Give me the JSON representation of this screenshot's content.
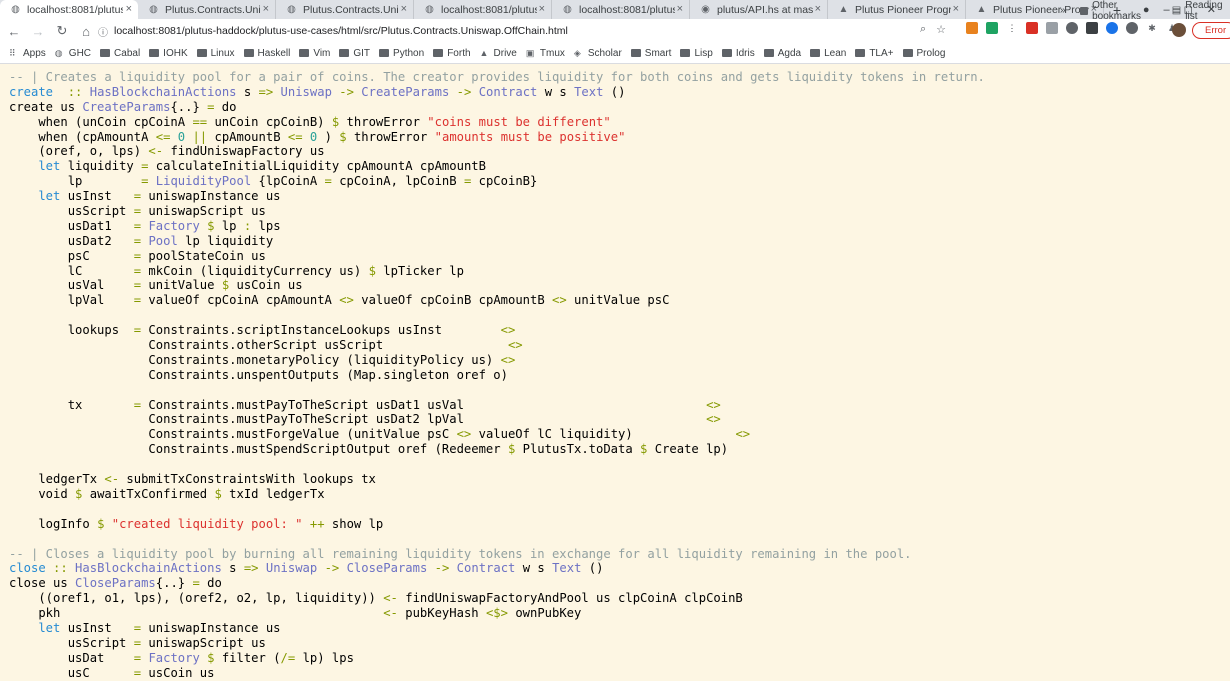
{
  "tabs": [
    {
      "label": "localhost:8081/plutus",
      "icon": "globe-icon",
      "active": true
    },
    {
      "label": "Plutus.Contracts.Unis",
      "icon": "globe-icon"
    },
    {
      "label": "Plutus.Contracts.Unis",
      "icon": "globe-icon"
    },
    {
      "label": "localhost:8081/plutus",
      "icon": "globe-icon"
    },
    {
      "label": "localhost:8081/plutus",
      "icon": "globe-icon"
    },
    {
      "label": "plutus/API.hs at mas",
      "icon": "github-icon"
    },
    {
      "label": "Plutus Pioneer Progr",
      "icon": "drive-icon"
    },
    {
      "label": "Plutus Pioneer Progr",
      "icon": "drive-icon"
    }
  ],
  "new_tab": "+",
  "window_controls": {
    "minimize": "–",
    "maximize": "◻",
    "close": "✕"
  },
  "toolbar": {
    "url": "localhost:8081/plutus-haddock/plutus-use-cases/html/src/Plutus.Contracts.Uniswap.OffChain.html",
    "error_label": "Error"
  },
  "bookmarks": [
    {
      "label": "Apps",
      "icon": "apps-icon"
    },
    {
      "label": "GHC",
      "icon": "globe-icon"
    },
    {
      "label": "Cabal",
      "icon": "folder-icon"
    },
    {
      "label": "IOHK",
      "icon": "folder-icon"
    },
    {
      "label": "Linux",
      "icon": "folder-icon"
    },
    {
      "label": "Haskell",
      "icon": "folder-icon"
    },
    {
      "label": "Vim",
      "icon": "folder-icon"
    },
    {
      "label": "GIT",
      "icon": "folder-icon"
    },
    {
      "label": "Python",
      "icon": "folder-icon"
    },
    {
      "label": "Forth",
      "icon": "folder-icon"
    },
    {
      "label": "Drive",
      "icon": "drive-icon"
    },
    {
      "label": "Tmux",
      "icon": "tmux-icon"
    },
    {
      "label": "Scholar",
      "icon": "scholar-icon"
    },
    {
      "label": "Smart",
      "icon": "folder-icon"
    },
    {
      "label": "Lisp",
      "icon": "folder-icon"
    },
    {
      "label": "Idris",
      "icon": "folder-icon"
    },
    {
      "label": "Agda",
      "icon": "folder-icon"
    },
    {
      "label": "Lean",
      "icon": "folder-icon"
    },
    {
      "label": "TLA+",
      "icon": "folder-icon"
    },
    {
      "label": "Prolog",
      "icon": "folder-icon"
    }
  ],
  "bookmarks_overflow": "»",
  "other_bookmarks": "Other bookmarks",
  "reading_list": "Reading list",
  "code_lines": [
    [
      [
        "c",
        "-- | Creates a liquidity pool for a pair of coins. The creator provides liquidity for both coins and gets liquidity tokens in return."
      ]
    ],
    [
      [
        "k",
        "create"
      ],
      [
        "",
        "  "
      ],
      [
        "op",
        "::"
      ],
      [
        "",
        ""
      ],
      [
        "ty",
        " HasBlockchainActions"
      ],
      [
        "",
        " s "
      ],
      [
        "op",
        "=>"
      ],
      [
        "ty",
        " Uniswap"
      ],
      [
        "",
        " "
      ],
      [
        "op",
        "->"
      ],
      [
        "ty",
        " CreateParams"
      ],
      [
        "",
        " "
      ],
      [
        "op",
        "->"
      ],
      [
        "ty",
        " Contract"
      ],
      [
        "",
        " w s "
      ],
      [
        "ty",
        "Text"
      ],
      [
        "",
        " ()"
      ]
    ],
    [
      [
        "",
        "create us "
      ],
      [
        "ty",
        "CreateParams"
      ],
      [
        "",
        "{..} "
      ],
      [
        "op",
        "="
      ],
      [
        "",
        " do"
      ]
    ],
    [
      [
        "",
        "    when (unCoin cpCoinA "
      ],
      [
        "op",
        "=="
      ],
      [
        "",
        " unCoin cpCoinB) "
      ],
      [
        "op",
        "$"
      ],
      [
        "",
        " throwError "
      ],
      [
        "st",
        "\"coins must be different\""
      ]
    ],
    [
      [
        "",
        "    when (cpAmountA "
      ],
      [
        "op",
        "<="
      ],
      [
        "",
        " "
      ],
      [
        "n",
        "0"
      ],
      [
        "",
        " "
      ],
      [
        "op",
        "||"
      ],
      [
        "",
        " cpAmountB "
      ],
      [
        "op",
        "<="
      ],
      [
        "",
        " "
      ],
      [
        "n",
        "0"
      ],
      [
        "",
        " ) "
      ],
      [
        "op",
        "$"
      ],
      [
        "",
        " throwError "
      ],
      [
        "st",
        "\"amounts must be positive\""
      ]
    ],
    [
      [
        "",
        "    (oref, o, lps) "
      ],
      [
        "op",
        "<-"
      ],
      [
        "",
        " findUniswapFactory us"
      ]
    ],
    [
      [
        "k",
        "    let"
      ],
      [
        "",
        " liquidity "
      ],
      [
        "op",
        "="
      ],
      [
        "",
        " calculateInitialLiquidity cpAmountA cpAmountB"
      ]
    ],
    [
      [
        "",
        "        lp        "
      ],
      [
        "op",
        "="
      ],
      [
        "",
        " "
      ],
      [
        "ty",
        "LiquidityPool"
      ],
      [
        "",
        " {lpCoinA "
      ],
      [
        "op",
        "="
      ],
      [
        "",
        " cpCoinA, lpCoinB "
      ],
      [
        "op",
        "="
      ],
      [
        "",
        " cpCoinB}"
      ]
    ],
    [
      [
        "k",
        "    let"
      ],
      [
        "",
        " usInst   "
      ],
      [
        "op",
        "="
      ],
      [
        "",
        " uniswapInstance us"
      ]
    ],
    [
      [
        "",
        "        usScript "
      ],
      [
        "op",
        "="
      ],
      [
        "",
        " uniswapScript us"
      ]
    ],
    [
      [
        "",
        "        usDat1   "
      ],
      [
        "op",
        "="
      ],
      [
        "",
        " "
      ],
      [
        "ty",
        "Factory"
      ],
      [
        "",
        " "
      ],
      [
        "op",
        "$"
      ],
      [
        "",
        " lp "
      ],
      [
        "op",
        ":"
      ],
      [
        "",
        " lps"
      ]
    ],
    [
      [
        "",
        "        usDat2   "
      ],
      [
        "op",
        "="
      ],
      [
        "",
        " "
      ],
      [
        "ty",
        "Pool"
      ],
      [
        "",
        " lp liquidity"
      ]
    ],
    [
      [
        "",
        "        psC      "
      ],
      [
        "op",
        "="
      ],
      [
        "",
        " poolStateCoin us"
      ]
    ],
    [
      [
        "",
        "        lC       "
      ],
      [
        "op",
        "="
      ],
      [
        "",
        " mkCoin (liquidityCurrency us) "
      ],
      [
        "op",
        "$"
      ],
      [
        "",
        " lpTicker lp"
      ]
    ],
    [
      [
        "",
        "        usVal    "
      ],
      [
        "op",
        "="
      ],
      [
        "",
        " unitValue "
      ],
      [
        "op",
        "$"
      ],
      [
        "",
        " usCoin us"
      ]
    ],
    [
      [
        "",
        "        lpVal    "
      ],
      [
        "op",
        "="
      ],
      [
        "",
        " valueOf cpCoinA cpAmountA "
      ],
      [
        "op",
        "<>"
      ],
      [
        "",
        " valueOf cpCoinB cpAmountB "
      ],
      [
        "op",
        "<>"
      ],
      [
        "",
        " unitValue psC"
      ]
    ],
    [
      [
        "",
        ""
      ]
    ],
    [
      [
        "",
        "        lookups  "
      ],
      [
        "op",
        "="
      ],
      [
        "",
        " Constraints.scriptInstanceLookups usInst        "
      ],
      [
        "op",
        "<>"
      ]
    ],
    [
      [
        "",
        "                   Constraints.otherScript usScript                 "
      ],
      [
        "op",
        "<>"
      ]
    ],
    [
      [
        "",
        "                   Constraints.monetaryPolicy (liquidityPolicy us) "
      ],
      [
        "op",
        "<>"
      ]
    ],
    [
      [
        "",
        "                   Constraints.unspentOutputs (Map.singleton oref o)"
      ]
    ],
    [
      [
        "",
        ""
      ]
    ],
    [
      [
        "",
        "        tx       "
      ],
      [
        "op",
        "="
      ],
      [
        "",
        " Constraints.mustPayToTheScript usDat1 usVal                                 "
      ],
      [
        "op",
        "<>"
      ]
    ],
    [
      [
        "",
        "                   Constraints.mustPayToTheScript usDat2 lpVal                                 "
      ],
      [
        "op",
        "<>"
      ]
    ],
    [
      [
        "",
        "                   Constraints.mustForgeValue (unitValue psC "
      ],
      [
        "op",
        "<>"
      ],
      [
        "",
        " valueOf lC liquidity)              "
      ],
      [
        "op",
        "<>"
      ]
    ],
    [
      [
        "",
        "                   Constraints.mustSpendScriptOutput oref (Redeemer "
      ],
      [
        "op",
        "$"
      ],
      [
        "",
        " PlutusTx.toData "
      ],
      [
        "op",
        "$"
      ],
      [
        "",
        " Create lp)"
      ]
    ],
    [
      [
        "",
        ""
      ]
    ],
    [
      [
        "",
        "    ledgerTx "
      ],
      [
        "op",
        "<-"
      ],
      [
        "",
        " submitTxConstraintsWith lookups tx"
      ]
    ],
    [
      [
        "",
        "    void "
      ],
      [
        "op",
        "$"
      ],
      [
        "",
        " awaitTxConfirmed "
      ],
      [
        "op",
        "$"
      ],
      [
        "",
        " txId ledgerTx"
      ]
    ],
    [
      [
        "",
        ""
      ]
    ],
    [
      [
        "",
        "    logInfo "
      ],
      [
        "op",
        "$"
      ],
      [
        "",
        " "
      ],
      [
        "st",
        "\"created liquidity pool: \""
      ],
      [
        "",
        " "
      ],
      [
        "op",
        "++"
      ],
      [
        "",
        " show lp"
      ]
    ],
    [
      [
        "",
        ""
      ]
    ],
    [
      [
        "c",
        "-- | Closes a liquidity pool by burning all remaining liquidity tokens in exchange for all liquidity remaining in the pool."
      ]
    ],
    [
      [
        "k",
        "close"
      ],
      [
        "",
        " "
      ],
      [
        "op",
        "::"
      ],
      [
        "ty",
        " HasBlockchainActions"
      ],
      [
        "",
        " s "
      ],
      [
        "op",
        "=>"
      ],
      [
        "ty",
        " Uniswap"
      ],
      [
        "",
        " "
      ],
      [
        "op",
        "->"
      ],
      [
        "ty",
        " CloseParams"
      ],
      [
        "",
        " "
      ],
      [
        "op",
        "->"
      ],
      [
        "ty",
        " Contract"
      ],
      [
        "",
        " w s "
      ],
      [
        "ty",
        "Text"
      ],
      [
        "",
        " ()"
      ]
    ],
    [
      [
        "",
        "close us "
      ],
      [
        "ty",
        "CloseParams"
      ],
      [
        "",
        "{..} "
      ],
      [
        "op",
        "="
      ],
      [
        "",
        " do"
      ]
    ],
    [
      [
        "",
        "    ((oref1, o1, lps), (oref2, o2, lp, liquidity)) "
      ],
      [
        "op",
        "<-"
      ],
      [
        "",
        " findUniswapFactoryAndPool us clpCoinA clpCoinB"
      ]
    ],
    [
      [
        "",
        "    pkh                                            "
      ],
      [
        "op",
        "<-"
      ],
      [
        "",
        " pubKeyHash "
      ],
      [
        "op",
        "<$>"
      ],
      [
        "",
        " ownPubKey"
      ]
    ],
    [
      [
        "k",
        "    let"
      ],
      [
        "",
        " usInst   "
      ],
      [
        "op",
        "="
      ],
      [
        "",
        " uniswapInstance us"
      ]
    ],
    [
      [
        "",
        "        usScript "
      ],
      [
        "op",
        "="
      ],
      [
        "",
        " uniswapScript us"
      ]
    ],
    [
      [
        "",
        "        usDat    "
      ],
      [
        "op",
        "="
      ],
      [
        "",
        " "
      ],
      [
        "ty",
        "Factory"
      ],
      [
        "",
        " "
      ],
      [
        "op",
        "$"
      ],
      [
        "",
        " filter ("
      ],
      [
        "op",
        "/="
      ],
      [
        "",
        " lp) lps"
      ]
    ],
    [
      [
        "",
        "        usC      "
      ],
      [
        "op",
        "="
      ],
      [
        "",
        " usCoin us"
      ]
    ]
  ]
}
